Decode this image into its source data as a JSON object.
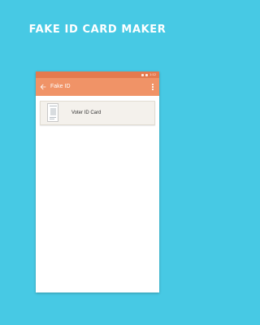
{
  "banner": {
    "headline": "FAKE ID CARD MAKER"
  },
  "status_bar": {
    "time": "1:12"
  },
  "app_bar": {
    "title": "Fake ID",
    "back_icon": "arrow-left-icon",
    "menu_icon": "more-vert-icon"
  },
  "list": {
    "items": [
      {
        "label": "Voter ID Card",
        "icon": "id-card-thumbnail"
      }
    ]
  },
  "colors": {
    "background": "#47c9e4",
    "status_bar": "#e47a4e",
    "app_bar": "#f09367",
    "list_item": "#f4f1ec"
  }
}
